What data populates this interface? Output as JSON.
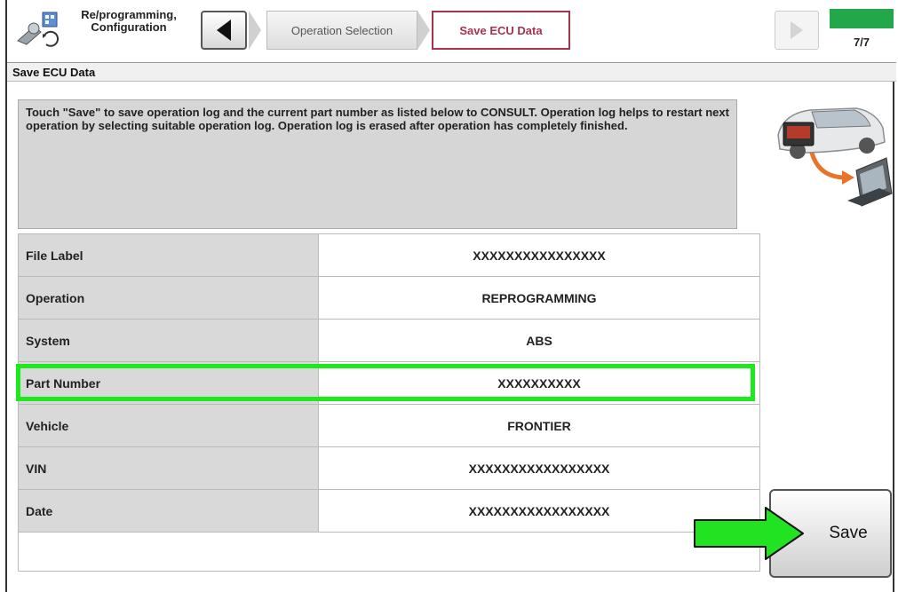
{
  "header": {
    "app_title": "Re/programming, Configuration",
    "breadcrumbs": [
      "Operation Selection",
      "Save ECU Data"
    ],
    "step": "7/7",
    "progress": 1.0
  },
  "page_title": "Save ECU Data",
  "instructions": "Touch \"Save\" to save operation log and the current part number as listed below to CONSULT. Operation log helps to restart next operation by selecting suitable operation log. Operation log is erased after operation has completely finished.",
  "table": {
    "rows": [
      {
        "label": "File Label",
        "value": "XXXXXXXXXXXXXXXX"
      },
      {
        "label": "Operation",
        "value": "REPROGRAMMING"
      },
      {
        "label": "System",
        "value": "ABS"
      },
      {
        "label": "Part Number",
        "value": "XXXXXXXXXX"
      },
      {
        "label": "Vehicle",
        "value": "FRONTIER"
      },
      {
        "label": "VIN",
        "value": "XXXXXXXXXXXXXXXXX"
      },
      {
        "label": "Date",
        "value": "XXXXXXXXXXXXXXXXX"
      }
    ]
  },
  "save_label": "Save",
  "colors": {
    "progress": "#22a84a",
    "highlight": "#1ee81e",
    "active_crumb": "#a3344d",
    "label_cell": "#d9d9d9"
  },
  "icons": [
    "app-icon",
    "back-arrow-icon",
    "forward-arrow-icon",
    "car-to-laptop-icon",
    "green-arrow-icon"
  ]
}
